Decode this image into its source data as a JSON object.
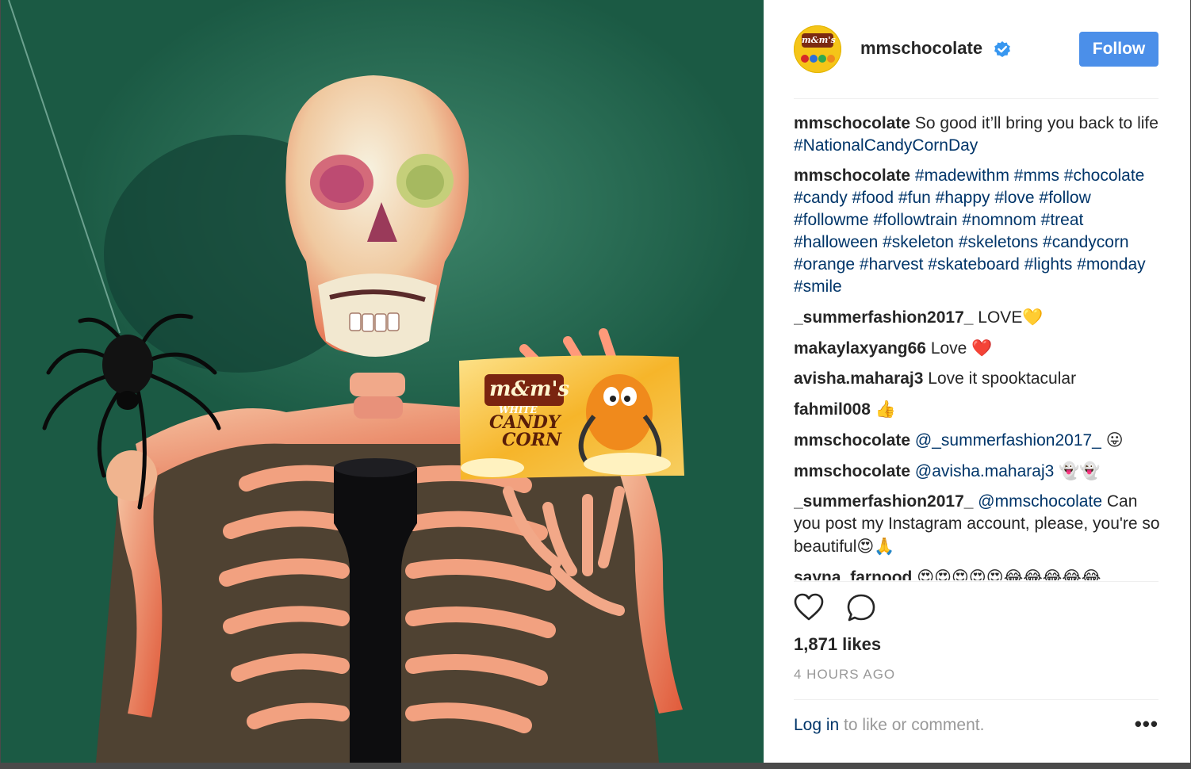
{
  "colors": {
    "accent": "#4b8fe9",
    "link": "#003569",
    "text": "#262626",
    "muted": "#999999",
    "photo_bg": "#1e5c46"
  },
  "photo": {
    "bag_brand": "m&m's",
    "bag_line1": "WHITE",
    "bag_line2": "CANDY",
    "bag_line3": "CORN"
  },
  "header": {
    "username": "mmschocolate",
    "avatar_text": "m&m's",
    "verified_icon": "verified-badge-icon",
    "follow_label": "Follow"
  },
  "caption": {
    "user": "mmschocolate",
    "text": "So good it’ll bring you back to life",
    "hashtag": "#NationalCandyCornDay"
  },
  "comments": [
    {
      "user": "mmschocolate",
      "text": "",
      "hashtags": "#madewithm #mms #chocolate #candy #food #fun #happy #love #follow #followme #followtrain #nomnom #treat #halloween #skeleton #skeletons #candycorn #orange #harvest #skateboard #lights #monday #smile"
    },
    {
      "user": "_summerfashion2017_",
      "text": "LOVE",
      "emoji": "💛"
    },
    {
      "user": "makaylaxyang66",
      "text": "Love",
      "emoji": "❤️"
    },
    {
      "user": "avisha.maharaj3",
      "text": "Love it spooktacular",
      "emoji": ""
    },
    {
      "user": "fahmil008",
      "text": "",
      "emoji": "👍"
    },
    {
      "user": "mmschocolate",
      "mention": "@_summerfashion2017_",
      "emoji": "😛"
    },
    {
      "user": "mmschocolate",
      "mention": "@avisha.maharaj3",
      "emoji": "👻👻"
    },
    {
      "user": "_summerfashion2017_",
      "mention": "@mmschocolate",
      "text": "Can you post my Instagram account, please, you're so beautiful",
      "emoji": "😍🙏"
    },
    {
      "user": "sayna_farnood",
      "text": "",
      "emoji": "😍😍😍😍😍😂😂😂😂😂"
    }
  ],
  "actions": {
    "like_icon": "heart-icon",
    "comment_icon": "comment-bubble-icon"
  },
  "likes": "1,871 likes",
  "timestamp": "4 HOURS AGO",
  "footer": {
    "login_link": "Log in",
    "login_rest": " to like or comment.",
    "more_icon": "more-options-icon",
    "more_label": "•••"
  }
}
